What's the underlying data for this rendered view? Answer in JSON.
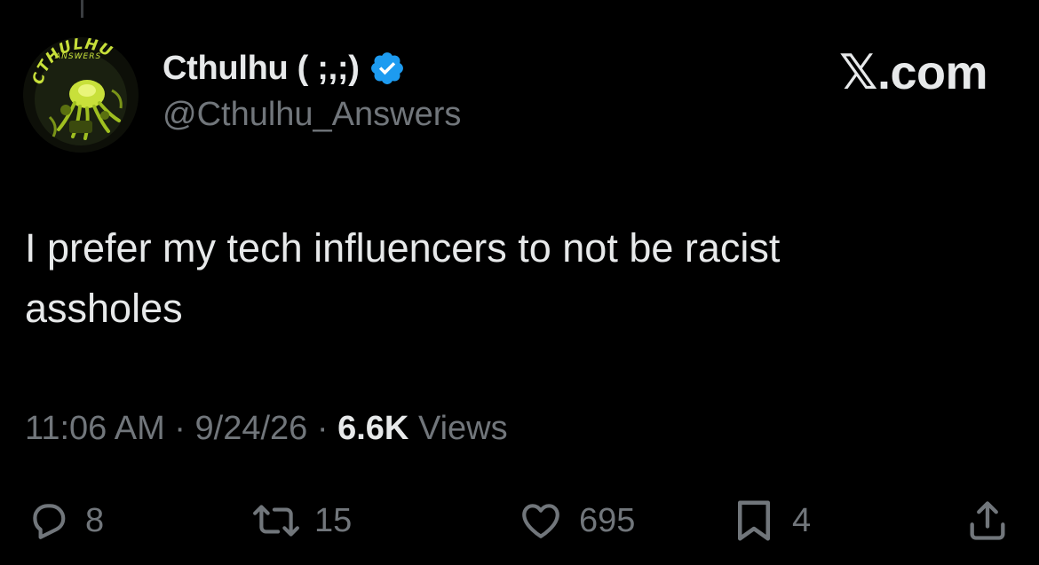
{
  "post": {
    "author": {
      "display_name": "Cthulhu ( ;,;)",
      "handle": "@Cthulhu_Answers",
      "verified": true,
      "avatar_text_top": "CTHULHU",
      "avatar_text_bottom": "ANSWERS"
    },
    "brand_label": "𝕏.com",
    "text_line1": "I prefer my tech influencers to not be racist",
    "text_line2": "assholes",
    "time": "11:06 AM",
    "separator": "·",
    "date": "9/24/26",
    "views_count": "6.6K",
    "views_label": "Views"
  },
  "actions": {
    "replies": "8",
    "reposts": "15",
    "likes": "695",
    "bookmarks": "4"
  },
  "colors": {
    "background": "#000000",
    "primary_text": "#e7e9ea",
    "secondary_text": "#71767b",
    "verified_blue": "#1d9bf0",
    "avatar_green": "#c8e03a"
  },
  "icons": [
    "verified-badge-icon",
    "reply-icon",
    "repost-icon",
    "like-icon",
    "bookmark-icon",
    "share-icon"
  ]
}
